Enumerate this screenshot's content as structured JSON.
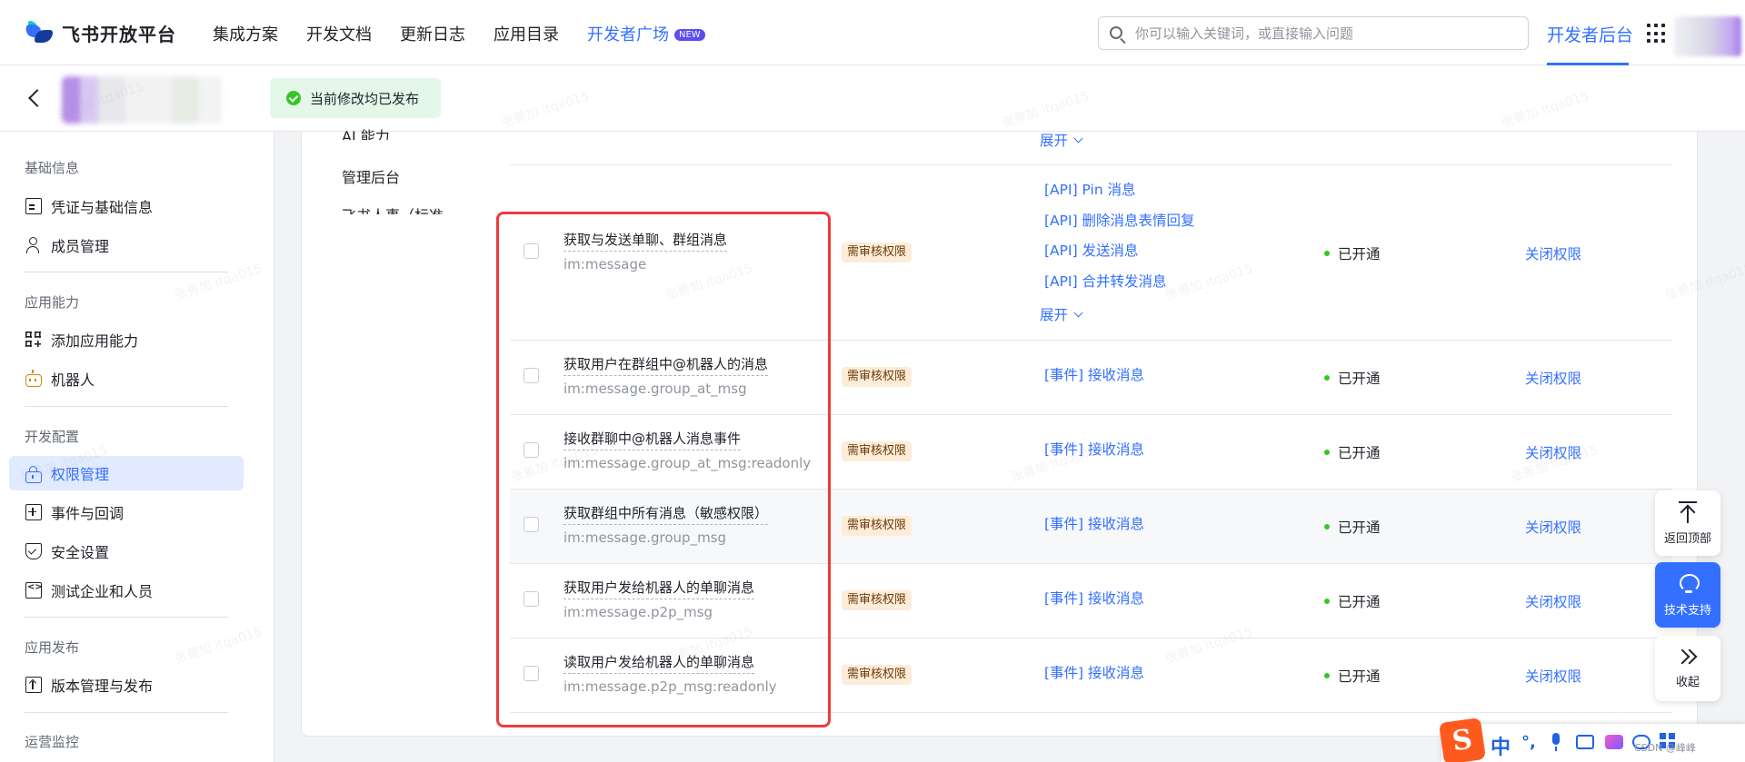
{
  "header": {
    "logo_text": "飞书开放平台",
    "nav": [
      {
        "label": "集成方案"
      },
      {
        "label": "开发文档"
      },
      {
        "label": "更新日志"
      },
      {
        "label": "应用目录"
      },
      {
        "label": "开发者广场",
        "badge": "NEW"
      }
    ],
    "search_placeholder": "你可以输入关键词，或直接输入问题",
    "dev_backend": "开发者后台"
  },
  "subheader": {
    "status_text": "当前修改均已发布"
  },
  "sidebar": {
    "sections": [
      {
        "title": "基础信息",
        "items": [
          {
            "label": "凭证与基础信息",
            "icon": "credential-icon"
          },
          {
            "label": "成员管理",
            "icon": "member-icon"
          }
        ]
      },
      {
        "title": "应用能力",
        "items": [
          {
            "label": "添加应用能力",
            "icon": "add-capability-icon"
          },
          {
            "label": "机器人",
            "icon": "robot-icon"
          }
        ]
      },
      {
        "title": "开发配置",
        "items": [
          {
            "label": "权限管理",
            "icon": "permission-icon",
            "active": true
          },
          {
            "label": "事件与回调",
            "icon": "event-icon"
          },
          {
            "label": "安全设置",
            "icon": "shield-icon"
          },
          {
            "label": "测试企业和人员",
            "icon": "code-icon"
          }
        ]
      },
      {
        "title": "应用发布",
        "items": [
          {
            "label": "版本管理与发布",
            "icon": "release-icon"
          }
        ]
      },
      {
        "title": "运营监控",
        "items": []
      }
    ]
  },
  "main": {
    "categories": [
      "AI 能力",
      "管理后台",
      "飞书人事（标准"
    ],
    "top_expand": "展开",
    "permissions": [
      {
        "name": "获取与发送单聊、群组消息",
        "code": "im:message",
        "tag": "需审核权限",
        "apis": [
          "[API] Pin 消息",
          "[API] 删除消息表情回复",
          "[API] 发送消息",
          "[API] 合并转发消息"
        ],
        "expand": "展开",
        "status": "已开通",
        "action": "关闭权限"
      },
      {
        "name": "获取用户在群组中@机器人的消息",
        "code": "im:message.group_at_msg",
        "tag": "需审核权限",
        "apis": [
          "[事件] 接收消息"
        ],
        "status": "已开通",
        "action": "关闭权限"
      },
      {
        "name": "接收群聊中@机器人消息事件",
        "code": "im:message.group_at_msg:readonly",
        "tag": "需审核权限",
        "apis": [
          "[事件] 接收消息"
        ],
        "status": "已开通",
        "action": "关闭权限"
      },
      {
        "name": "获取群组中所有消息（敏感权限）",
        "code": "im:message.group_msg",
        "tag": "需审核权限",
        "apis": [
          "[事件] 接收消息"
        ],
        "status": "已开通",
        "action": "关闭权限"
      },
      {
        "name": "获取用户发给机器人的单聊消息",
        "code": "im:message.p2p_msg",
        "tag": "需审核权限",
        "apis": [
          "[事件] 接收消息"
        ],
        "status": "已开通",
        "action": "关闭权限"
      },
      {
        "name": "读取用户发给机器人的单聊消息",
        "code": "im:message.p2p_msg:readonly",
        "tag": "需审核权限",
        "apis": [
          "[事件] 接收消息"
        ],
        "status": "已开通",
        "action": "关闭权限"
      }
    ]
  },
  "float_buttons": {
    "back_top": "返回顶部",
    "support": "技术支持",
    "collapse": "收起"
  },
  "ime": {
    "logo": "S",
    "lang": "中",
    "footer_text": "CSDN @峰峰"
  },
  "watermark": "张善加 itqa015",
  "colors": {
    "accent": "#3370ff",
    "success": "#34c724",
    "highlight_box": "#ee3b3b",
    "tag_bg": "#fdecd8"
  }
}
